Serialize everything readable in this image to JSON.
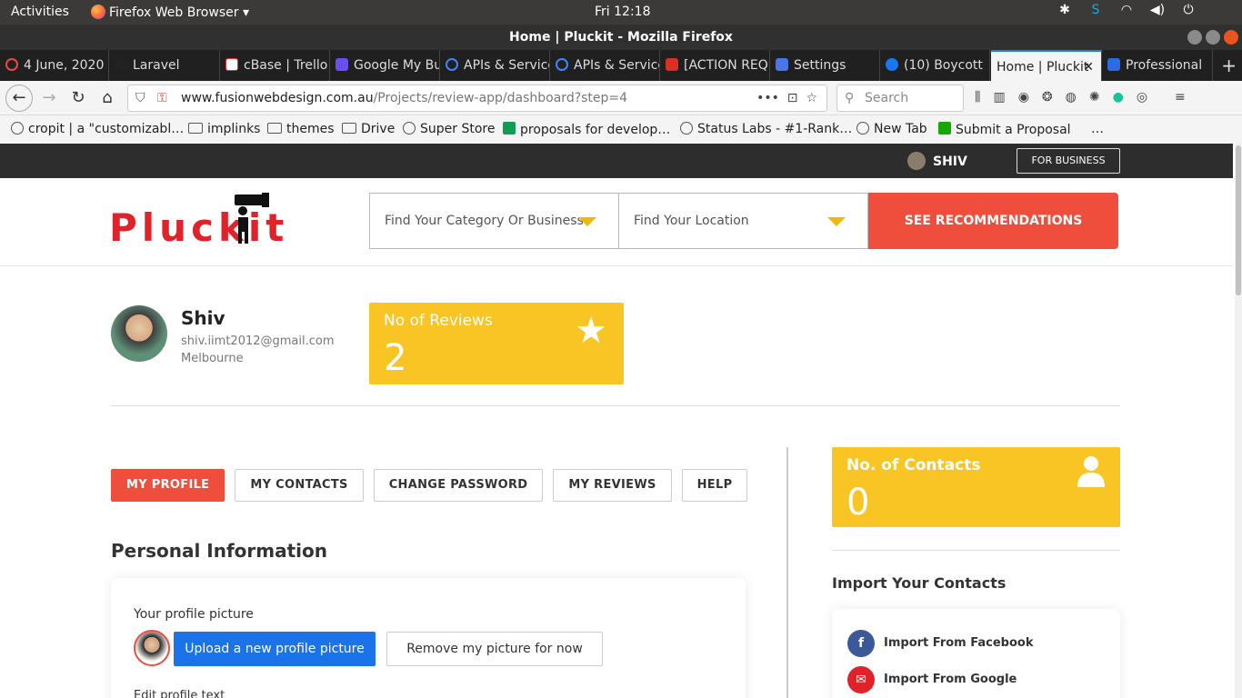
{
  "os": {
    "activities": "Activities",
    "app_name": "Firefox Web Browser",
    "clock": "Fri 12:18"
  },
  "window": {
    "title": "Home | Pluckit - Mozilla Firefox"
  },
  "tabs": [
    {
      "label": "4 June, 2020",
      "color": "#e84a4a"
    },
    {
      "label": "Laravel",
      "color": "#222222"
    },
    {
      "label": "cBase | Trello",
      "color": "#ffffff"
    },
    {
      "label": "Google My Business",
      "color": "#6a4ef0"
    },
    {
      "label": "APIs & Services",
      "color": "#4285f4"
    },
    {
      "label": "APIs & Services",
      "color": "#4285f4"
    },
    {
      "label": "[ACTION REQUIRED]",
      "color": "#d93025"
    },
    {
      "label": "Settings",
      "color": "#4a76e8"
    },
    {
      "label": "(10) Boycott",
      "color": "#1877f2"
    },
    {
      "label": "Home | Pluckit",
      "color": "#e0232a"
    },
    {
      "label": "Professional",
      "color": "#2d6be4"
    }
  ],
  "navbar": {
    "url_domain": "www.fusionwebdesign.com.au",
    "url_path": "/Projects/review-app/dashboard?step=4",
    "search_placeholder": "Search"
  },
  "bookmarks": [
    {
      "label": "cropit | a \"customizabl…",
      "icon": "globe"
    },
    {
      "label": "implinks",
      "icon": "folder"
    },
    {
      "label": "themes",
      "icon": "folder"
    },
    {
      "label": "Drive",
      "icon": "folder"
    },
    {
      "label": "Super Store",
      "icon": "globe"
    },
    {
      "label": "proposals for develop…",
      "icon": "sheets"
    },
    {
      "label": "Status Labs - #1-Rank…",
      "icon": "globe"
    },
    {
      "label": "New Tab",
      "icon": "globe"
    },
    {
      "label": "Submit a Proposal",
      "icon": "upwork"
    },
    {
      "label": "…",
      "icon": "more"
    }
  ],
  "site": {
    "user_name": "SHIV",
    "for_business": "FOR BUSINESS",
    "logo_text": "Pluckit",
    "search_category": "Find Your Category Or Business",
    "search_location": "Find Your Location",
    "see_button": "SEE RECOMMENDATIONS"
  },
  "profile": {
    "name": "Shiv",
    "email": "shiv.iimt2012@gmail.com",
    "city": "Melbourne"
  },
  "stats": {
    "reviews_label": "No of Reviews",
    "reviews_value": "2",
    "contacts_label": "No. of Contacts",
    "contacts_value": "0"
  },
  "profile_tabs": [
    "MY PROFILE",
    "MY CONTACTS",
    "CHANGE PASSWORD",
    "MY REVIEWS",
    "HELP"
  ],
  "personal": {
    "title": "Personal Information",
    "picture_label": "Your profile picture",
    "upload_btn": "Upload a new profile picture",
    "remove_btn": "Remove my picture for now",
    "edit_label": "Edit profile text"
  },
  "import": {
    "title": "Import Your Contacts",
    "facebook": "Import From Facebook",
    "google": "Import From Google"
  },
  "colors": {
    "brand_red": "#ee4e3b",
    "stat_yellow": "#f8c524",
    "primary_blue": "#1a73e8"
  }
}
